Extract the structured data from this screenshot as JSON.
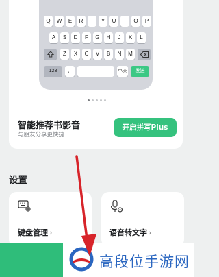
{
  "keyboard_preview": {
    "row1": [
      "Q",
      "W",
      "E",
      "R",
      "T",
      "Y",
      "U",
      "I",
      "O",
      "P"
    ],
    "row2": [
      "A",
      "S",
      "D",
      "F",
      "G",
      "H",
      "J",
      "K",
      "L"
    ],
    "row3": [
      "Z",
      "X",
      "C",
      "V",
      "B",
      "N",
      "M"
    ],
    "numbers_key": "123",
    "comma_key": "，",
    "lang_key": "中/英",
    "send_key": "发送"
  },
  "promo": {
    "title": "智能推荐书影音",
    "subtitle": "与朋友分享更快捷",
    "cta_label": "开启拼写Plus"
  },
  "settings": {
    "heading": "设置",
    "tiles": [
      {
        "label": "键盘管理",
        "icon": "keyboard-settings-icon"
      },
      {
        "label": "语音转文字",
        "icon": "microphone-settings-icon"
      }
    ],
    "chevron": "›"
  },
  "watermark": {
    "text": "高段位手游网"
  },
  "colors": {
    "accent": "#35c27e",
    "watermark_blue": "#2a66c0",
    "arrow_red": "#d7242a"
  }
}
